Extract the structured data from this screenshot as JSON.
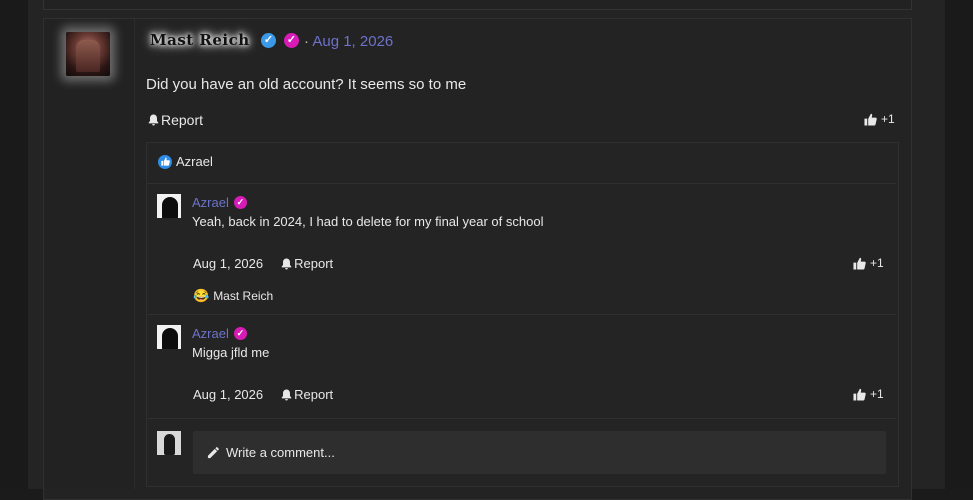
{
  "post": {
    "author": "Mast Reich",
    "date_prefix": "·",
    "date": "Aug 1, 2026",
    "body": "Did you have an old account? It seems so to me",
    "report_label": "Report",
    "like_count": "+1"
  },
  "reactions": {
    "name": "Azrael"
  },
  "comments": [
    {
      "author": "Azrael",
      "text": "Yeah, back in 2024, I had to delete for my final year of school",
      "date": "Aug 1, 2026",
      "report_label": "Report",
      "like_count": "+1",
      "reaction_emoji": "😂",
      "reaction_name": "Mast Reich"
    },
    {
      "author": "Azrael",
      "text": "Migga jfld me",
      "date": "Aug 1, 2026",
      "report_label": "Report",
      "like_count": "+1"
    }
  ],
  "composer": {
    "label": "Write a comment..."
  },
  "colors": {
    "link": "#6c73c9",
    "verified": "#3b9ae8",
    "badge": "#d81bb6",
    "like": "#2e8be6"
  }
}
